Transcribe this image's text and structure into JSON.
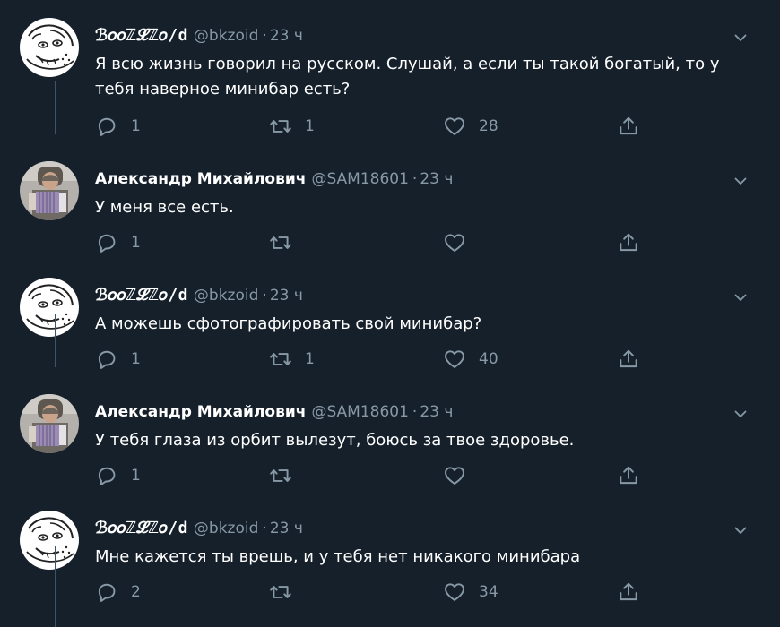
{
  "tweets": [
    {
      "author": "ℬ𝑜𝑜ℤ𝓛ℤ𝑜/d",
      "handle": "@bkzoid",
      "time": "23 ч",
      "text": "Я всю жизнь говорил на русском. Слушай, а если ты такой богатый, то у тебя наверное минибар есть?",
      "replies": "1",
      "retweets": "1",
      "likes": "28",
      "avatar": "sketch-face"
    },
    {
      "author": "Александр Михайлович",
      "handle": "@SAM18601",
      "time": "23 ч",
      "text": "У меня все есть.",
      "replies": "1",
      "retweets": "",
      "likes": "",
      "avatar": "accordion-player"
    },
    {
      "author": "ℬ𝑜𝑜ℤ𝓛ℤ𝑜/d",
      "handle": "@bkzoid",
      "time": "23 ч",
      "text": "А можешь сфотографировать свой минибар?",
      "replies": "1",
      "retweets": "1",
      "likes": "40",
      "avatar": "sketch-face"
    },
    {
      "author": "Александр Михайлович",
      "handle": "@SAM18601",
      "time": "23 ч",
      "text": "У тебя глаза из орбит вылезут, боюсь за твое здоровье.",
      "replies": "1",
      "retweets": "",
      "likes": "",
      "avatar": "accordion-player"
    },
    {
      "author": "ℬ𝑜𝑜ℤ𝓛ℤ𝑜/d",
      "handle": "@bkzoid",
      "time": "23 ч",
      "text": "Мне кажется ты врешь, и у тебя нет никакого минибара",
      "replies": "2",
      "retweets": "",
      "likes": "34",
      "avatar": "sketch-face"
    }
  ],
  "colors": {
    "background": "#15202b",
    "text": "#ffffff",
    "secondary": "#8899a6",
    "thread_line": "#3d5466"
  },
  "icons": [
    "reply-icon",
    "retweet-icon",
    "like-icon",
    "share-icon",
    "chevron-down-icon"
  ]
}
